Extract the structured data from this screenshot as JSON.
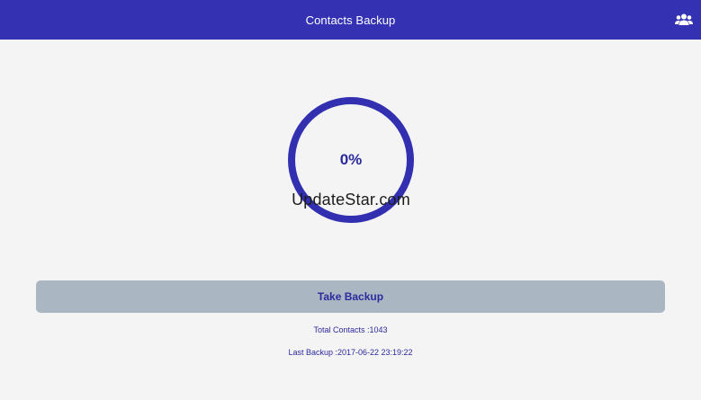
{
  "header": {
    "title": "Contacts Backup",
    "contacts_icon": "contacts-group-icon"
  },
  "progress": {
    "percent_label": "0%",
    "value": 0
  },
  "watermark": "UpdateStar.com",
  "actions": {
    "backup_label": "Take Backup"
  },
  "info": {
    "total_contacts": "Total Contacts :1043",
    "last_backup": "Last Backup :2017-06-22 23:19:22"
  },
  "colors": {
    "primary": "#3432b2",
    "ring": "#3230b0",
    "button_bg": "#aab7c2",
    "text_accent": "#2c2a9e",
    "background": "#f4f4f4"
  }
}
